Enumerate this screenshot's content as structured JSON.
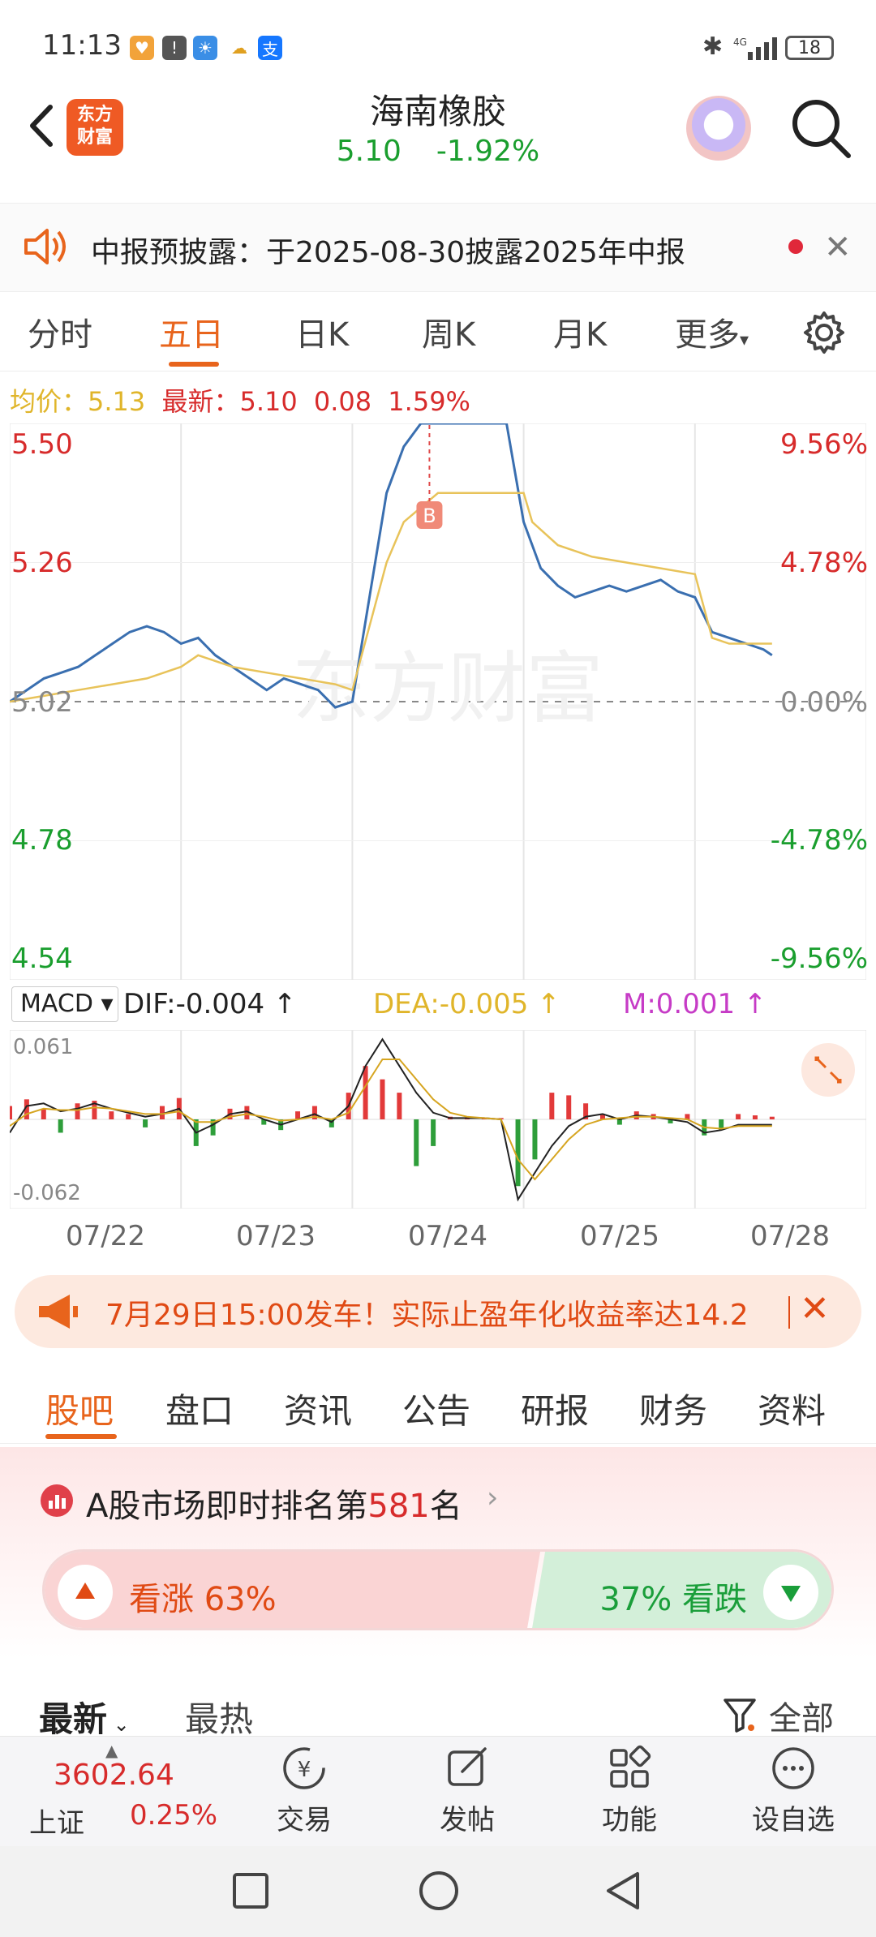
{
  "status_bar": {
    "time": "11:13",
    "battery": "18"
  },
  "header": {
    "logo_line1": "东方",
    "logo_line2": "财富",
    "title": "海南橡胶",
    "price": "5.10",
    "change_pct": "-1.92%"
  },
  "notice": {
    "text": "中报预披露：于2025-08-30披露2025年中报"
  },
  "chart_tabs": [
    "分时",
    "五日",
    "日K",
    "周K",
    "月K",
    "更多"
  ],
  "chart_tabs_active": 1,
  "avg_bar": {
    "avg_label": "均价：",
    "avg_value": "5.13",
    "latest_label": "最新：",
    "latest_value": "5.10",
    "change": "0.08",
    "change_pct": "1.59%"
  },
  "watermark": "东方财富",
  "marker_b": "B",
  "chart_data": {
    "type": "line",
    "title": "",
    "x_labels": [
      "07/22",
      "07/23",
      "07/24",
      "07/25",
      "07/28"
    ],
    "y_left_ticks": [
      "5.50",
      "5.26",
      "5.02",
      "4.78",
      "4.54"
    ],
    "y_right_ticks": [
      "9.56%",
      "4.78%",
      "0.00%",
      "-4.78%",
      "-9.56%"
    ],
    "ylim": [
      4.54,
      5.5
    ],
    "series": [
      {
        "name": "最新",
        "color": "#3a6fb0",
        "x": [
          0,
          0.1,
          0.2,
          0.3,
          0.4,
          0.5,
          0.6,
          0.7,
          0.8,
          0.9,
          1.0,
          1.1,
          1.2,
          1.3,
          1.4,
          1.5,
          1.6,
          1.7,
          1.8,
          1.9,
          2.0,
          2.1,
          2.2,
          2.3,
          2.4,
          2.5,
          2.6,
          2.7,
          2.8,
          2.9,
          3.0,
          3.1,
          3.2,
          3.3,
          3.4,
          3.5,
          3.6,
          3.7,
          3.8,
          3.9,
          4.0,
          4.1,
          4.2,
          4.3,
          4.4,
          4.45
        ],
        "values": [
          5.02,
          5.04,
          5.06,
          5.07,
          5.08,
          5.1,
          5.12,
          5.14,
          5.15,
          5.14,
          5.12,
          5.13,
          5.1,
          5.08,
          5.06,
          5.04,
          5.06,
          5.05,
          5.04,
          5.01,
          5.02,
          5.2,
          5.38,
          5.46,
          5.5,
          5.5,
          5.5,
          5.5,
          5.5,
          5.5,
          5.33,
          5.25,
          5.22,
          5.2,
          5.21,
          5.22,
          5.21,
          5.22,
          5.23,
          5.21,
          5.2,
          5.14,
          5.13,
          5.12,
          5.11,
          5.1
        ]
      },
      {
        "name": "均价",
        "color": "#e8c35a",
        "x": [
          0,
          0.2,
          0.4,
          0.6,
          0.8,
          1.0,
          1.1,
          1.3,
          1.5,
          1.7,
          1.9,
          2.0,
          2.1,
          2.2,
          2.3,
          2.5,
          2.7,
          2.9,
          3.0,
          3.05,
          3.2,
          3.4,
          3.6,
          3.8,
          4.0,
          4.1,
          4.2,
          4.3,
          4.45
        ],
        "values": [
          5.02,
          5.03,
          5.04,
          5.05,
          5.06,
          5.08,
          5.1,
          5.08,
          5.07,
          5.06,
          5.05,
          5.04,
          5.15,
          5.26,
          5.33,
          5.38,
          5.38,
          5.38,
          5.38,
          5.33,
          5.29,
          5.27,
          5.26,
          5.25,
          5.24,
          5.13,
          5.12,
          5.12,
          5.12
        ]
      }
    ]
  },
  "macd": {
    "selector": "MACD ▾",
    "dif": "DIF:-0.004 ↑",
    "dea": "DEA:-0.005 ↑",
    "m": "M:0.001 ↑",
    "max": "0.061",
    "min": "-0.062",
    "colors": {
      "up": "#e23a3a",
      "down": "#2e9e3a",
      "dif": "#222222",
      "dea": "#d6a520"
    },
    "bars": [
      0.01,
      0.015,
      0.008,
      -0.01,
      0.012,
      0.014,
      0.006,
      0.004,
      -0.006,
      0.01,
      0.016,
      -0.02,
      -0.012,
      0.008,
      0.01,
      -0.004,
      -0.008,
      0.006,
      0.01,
      -0.006,
      0.02,
      0.04,
      0.03,
      0.02,
      -0.035,
      -0.02,
      0.002,
      0.001,
      0.001,
      0.001,
      -0.05,
      -0.03,
      0.02,
      0.018,
      0.012,
      0.004,
      -0.004,
      0.006,
      0.004,
      -0.003,
      0.004,
      -0.012,
      -0.008,
      0.004,
      0.003,
      0.002
    ],
    "dif_line": [
      -0.01,
      0.01,
      0.012,
      0.006,
      0.008,
      0.012,
      0.008,
      0.005,
      0.002,
      0.004,
      0.008,
      -0.01,
      -0.004,
      0.004,
      0.006,
      0.0,
      -0.004,
      0.0,
      0.004,
      -0.002,
      0.01,
      0.04,
      0.06,
      0.04,
      0.02,
      0.005,
      0.001,
      0.001,
      0.001,
      0.0,
      -0.06,
      -0.04,
      -0.02,
      -0.005,
      0.002,
      0.004,
      0.0,
      0.003,
      0.002,
      0.0,
      -0.002,
      -0.01,
      -0.008,
      -0.004,
      -0.004,
      -0.004
    ],
    "dea_line": [
      -0.005,
      0.004,
      0.008,
      0.007,
      0.007,
      0.009,
      0.008,
      0.006,
      0.004,
      0.004,
      0.006,
      -0.002,
      -0.002,
      0.002,
      0.004,
      0.002,
      -0.001,
      0.0,
      0.002,
      0.0,
      0.005,
      0.025,
      0.045,
      0.045,
      0.03,
      0.015,
      0.005,
      0.002,
      0.001,
      0.0,
      -0.03,
      -0.045,
      -0.03,
      -0.015,
      -0.004,
      0.0,
      0.001,
      0.002,
      0.002,
      0.001,
      0.0,
      -0.006,
      -0.007,
      -0.005,
      -0.005,
      -0.005
    ]
  },
  "promo": {
    "text": "7月29日15:00发车！实际止盈年化收益率达14.2"
  },
  "sub_tabs": [
    "股吧",
    "盘口",
    "资讯",
    "公告",
    "研报",
    "财务",
    "资料"
  ],
  "sub_tabs_active": 0,
  "ranking": {
    "prefix": "A股市场即时排名第",
    "rank": "581",
    "suffix": "名"
  },
  "vote": {
    "up_label": "看涨 63%",
    "down_label": "37% 看跌",
    "up_pct": 63
  },
  "filters": {
    "newest": "最新",
    "hot": "最热",
    "all": "全部"
  },
  "bottom_nav": {
    "index_value": "3602.64",
    "index_name": "上证",
    "index_pct": "0.25%",
    "items": [
      "交易",
      "发帖",
      "功能",
      "设自选"
    ]
  }
}
